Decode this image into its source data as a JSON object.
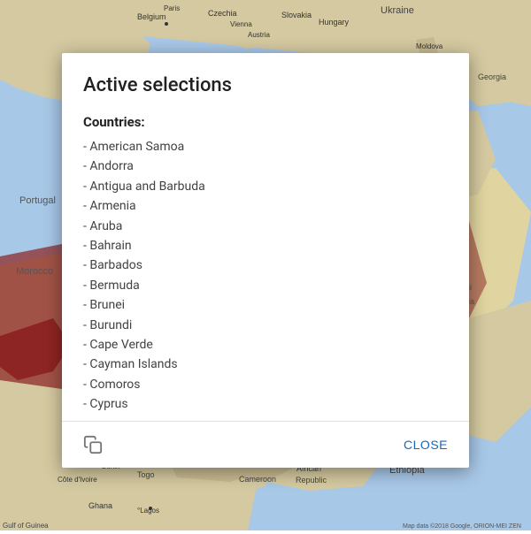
{
  "map": {
    "background_color": "#b8d4e8",
    "attribution": "Map data ©2018 Google, ORION-MEI ZEN"
  },
  "dialog": {
    "title": "Active selections",
    "countries_label": "Countries:",
    "countries": [
      "American Samoa",
      "Andorra",
      "Antigua and Barbuda",
      "Armenia",
      "Aruba",
      "Bahrain",
      "Barbados",
      "Bermuda",
      "Brunei",
      "Burundi",
      "Cape Verde",
      "Cayman Islands",
      "Comoros",
      "Cyprus"
    ],
    "copy_icon_label": "copy",
    "close_button_label": "CLOSE"
  }
}
